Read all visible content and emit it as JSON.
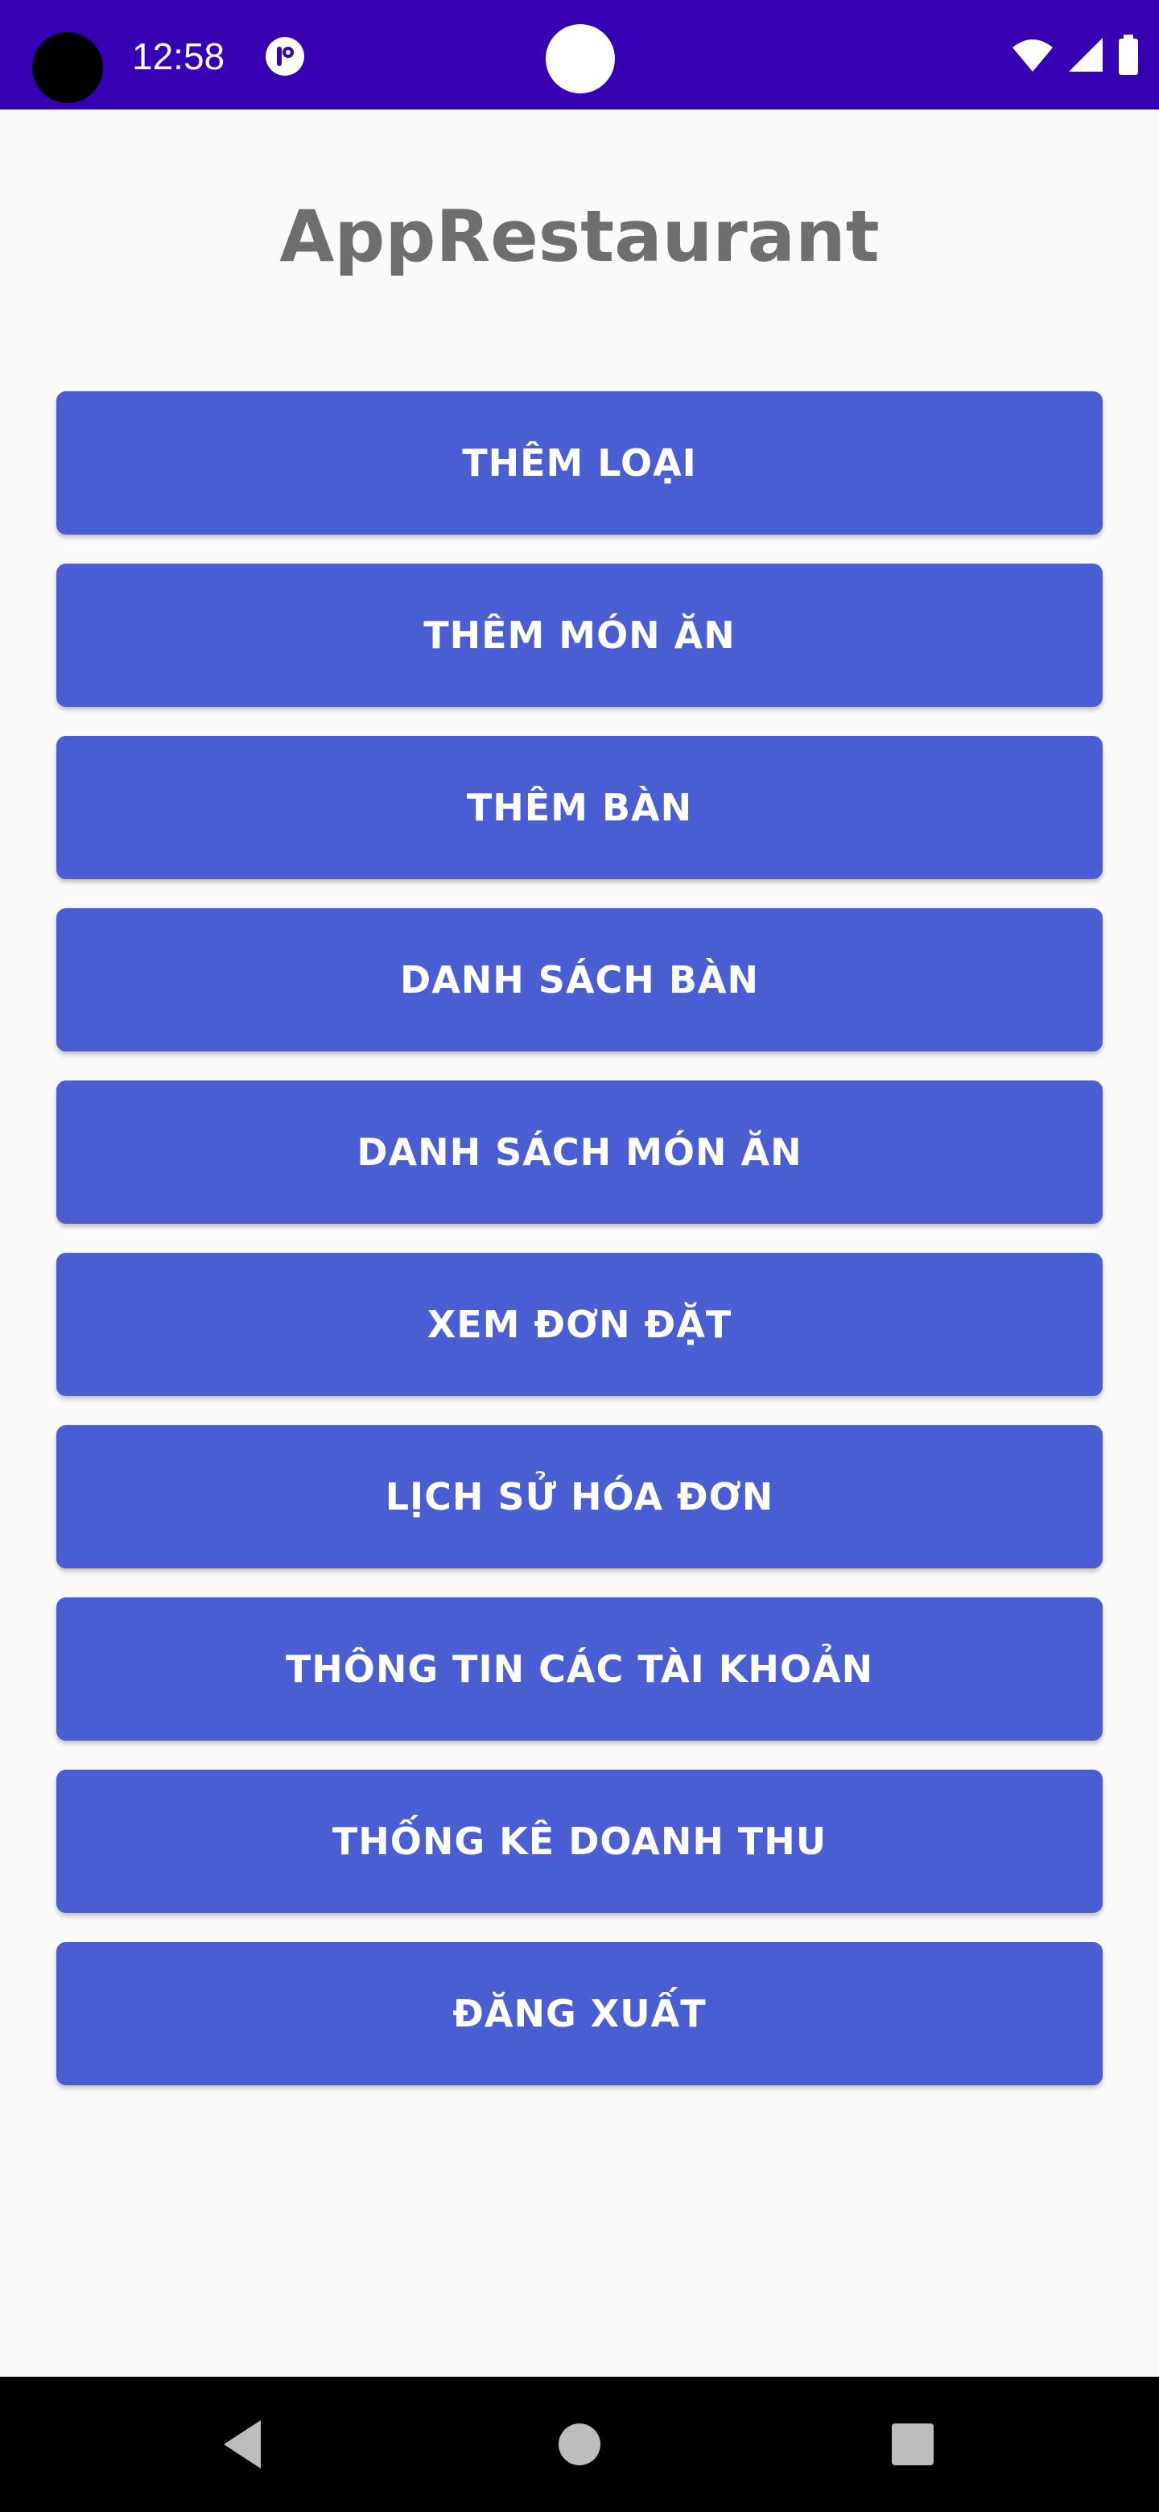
{
  "status_bar": {
    "time": "12:58",
    "icons": [
      "camera-cutout",
      "notification-icon",
      "front-camera",
      "wifi-icon",
      "signal-icon",
      "battery-icon"
    ]
  },
  "app": {
    "title": "AppRestaurant"
  },
  "menu": {
    "items": [
      {
        "label": "THÊM LOẠI"
      },
      {
        "label": "THÊM MÓN ĂN"
      },
      {
        "label": "THÊM BÀN"
      },
      {
        "label": "DANH SÁCH BÀN"
      },
      {
        "label": "DANH SÁCH MÓN ĂN"
      },
      {
        "label": "XEM ĐƠN ĐẶT"
      },
      {
        "label": "LỊCH SỬ HÓA ĐƠN"
      },
      {
        "label": "THÔNG TIN CÁC TÀI KHOẢN"
      },
      {
        "label": "THỐNG KÊ DOANH THU"
      },
      {
        "label": "ĐĂNG XUẤT"
      }
    ]
  },
  "nav_bar": {
    "icons": [
      "back-icon",
      "home-icon",
      "recents-icon"
    ]
  },
  "colors": {
    "status_bar": "#3700b3",
    "button": "#4a5ed4",
    "button_text": "#ffffff",
    "background": "#fafafa",
    "title": "#6e6e6e",
    "nav_bar": "#000000"
  }
}
